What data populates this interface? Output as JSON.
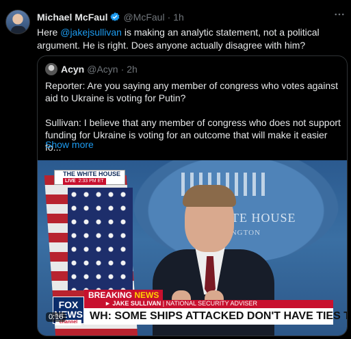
{
  "tweet": {
    "author_name": "Michael McFaul",
    "author_handle": "@McFaul",
    "separator": "·",
    "time": "1h",
    "more_icon": "more-icon",
    "text_before": "Here ",
    "mention": "@jakejsullivan",
    "text_after": " is making an analytic statement, not a political argument. He is right.  Does anyone actually disagree with him?"
  },
  "quote": {
    "author_name": "Acyn",
    "author_handle": "@Acyn",
    "separator": "·",
    "time": "2h",
    "text": "Reporter: Are you saying any member of congress who votes against aid to Ukraine is voting for Putin?\n\nSullivan: I believe that any member of congress who does not support funding for Ukraine is voting for an outcome that will make it easier fo...",
    "show_more": "Show more"
  },
  "media": {
    "live_top": "THE WHITE HOUSE",
    "live_word": "LIVE",
    "live_time": "2:33 PM ET",
    "seal_line1": "WHITE HOUSE",
    "seal_line2": "SHINGTON",
    "fox_logo": "FOX",
    "fox_logo_sub": "NEWS",
    "fox_channel": "channel",
    "breaking": "BREAKING",
    "breaking_news": "NEWS",
    "speaker_name": "JAKE SULLIVAN",
    "speaker_title": "| NATIONAL SECURITY ADVISER",
    "headline": "WH: SOME SHIPS ATTACKED DON'T HAVE TIES TO ISRAEL",
    "timestamp": "0:16"
  },
  "colors": {
    "accent": "#1d9bf0",
    "background": "#000000",
    "muted": "#71767b"
  }
}
